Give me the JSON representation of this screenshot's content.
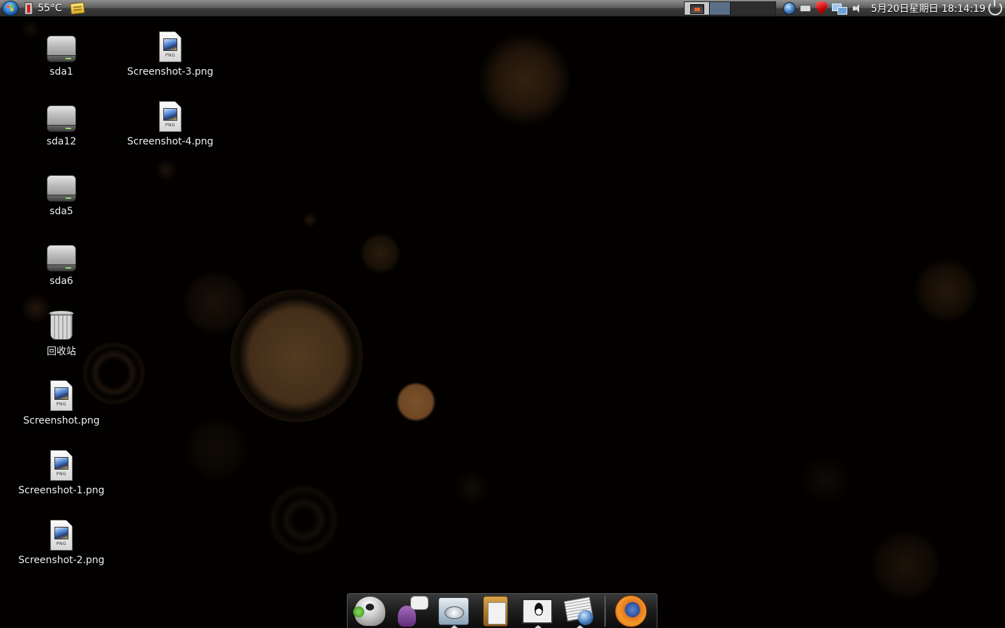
{
  "top_panel": {
    "temperature": "55°C",
    "clock": "5月20日星期日 18:14:19"
  },
  "desktop": {
    "icons": [
      {
        "label": "sda1",
        "type": "drive"
      },
      {
        "label": "sda12",
        "type": "drive"
      },
      {
        "label": "sda5",
        "type": "drive"
      },
      {
        "label": "sda6",
        "type": "drive"
      },
      {
        "label": "回收站",
        "type": "trash"
      },
      {
        "label": "Screenshot.png",
        "type": "png"
      },
      {
        "label": "Screenshot-1.png",
        "type": "png"
      },
      {
        "label": "Screenshot-2.png",
        "type": "png"
      },
      {
        "label": "Screenshot-3.png",
        "type": "png"
      },
      {
        "label": "Screenshot-4.png",
        "type": "png"
      }
    ],
    "file_tag": "PNG"
  },
  "dock": {
    "items": [
      {
        "icon": "msn-messenger-icon",
        "running": false
      },
      {
        "icon": "pidgin-icon",
        "running": false
      },
      {
        "icon": "file-manager-icon",
        "running": true
      },
      {
        "icon": "clipboard-icon",
        "running": false
      },
      {
        "icon": "terminal-icon",
        "running": true
      },
      {
        "icon": "news-reader-icon",
        "running": true
      },
      {
        "icon": "firefox-icon",
        "running": false
      }
    ]
  },
  "colors": {
    "wallpaper": "#020100",
    "bokeh_accent": "#7a5028",
    "panel_top": "#8f8f8f",
    "panel_bottom": "#2e2e2e"
  }
}
